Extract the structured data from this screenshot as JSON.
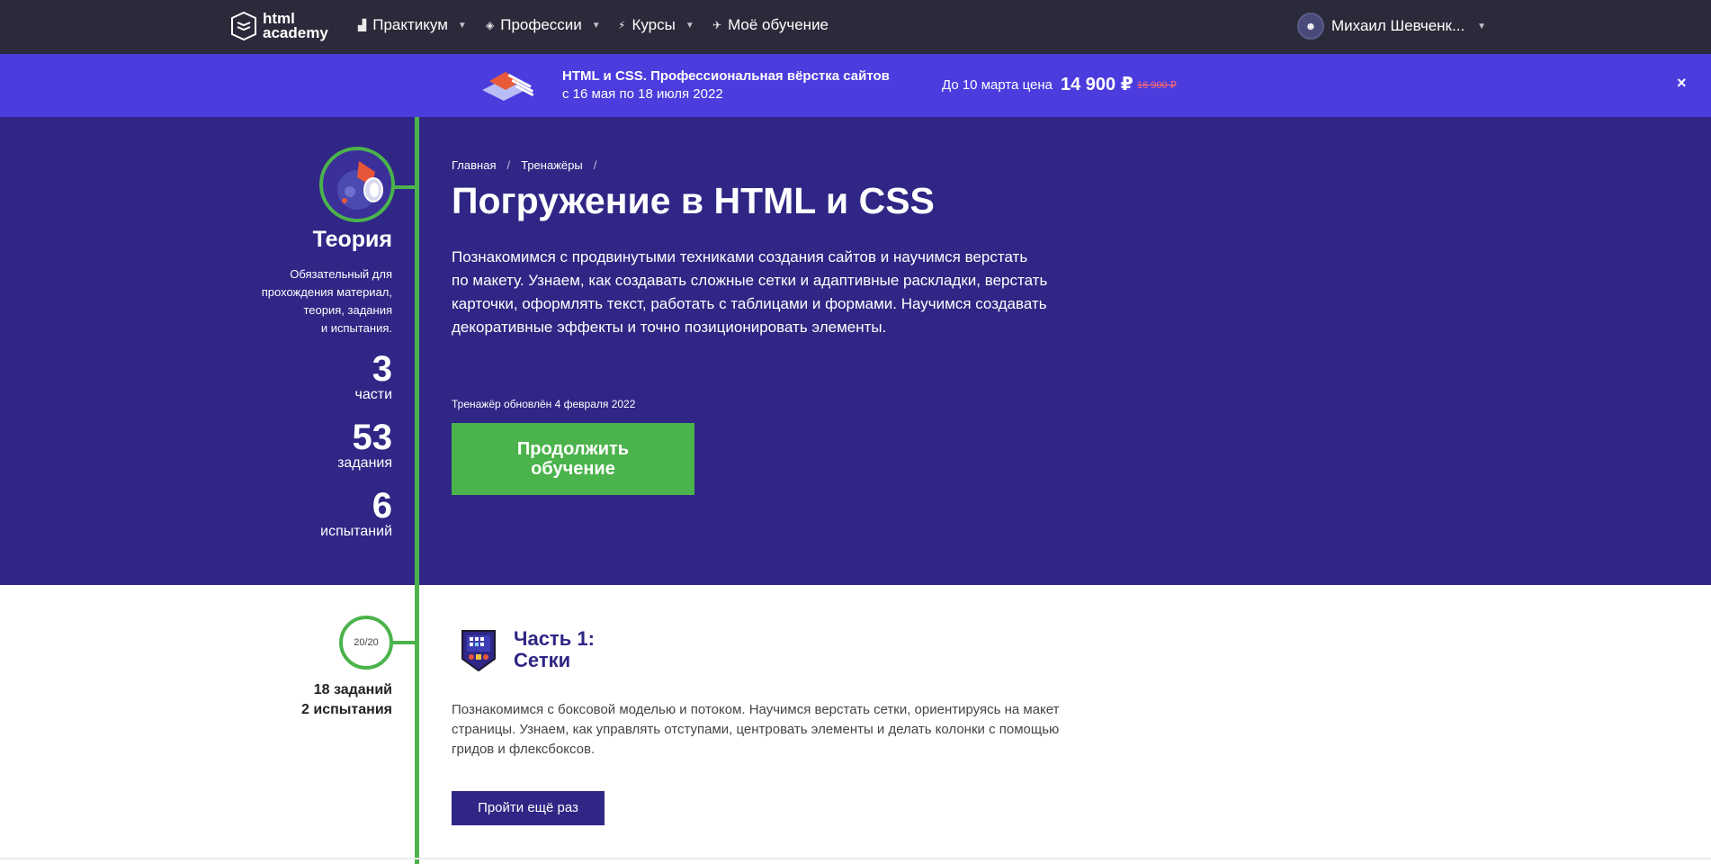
{
  "nav": {
    "logo_line1": "html",
    "logo_line2": "academy",
    "items": [
      {
        "label": "Практикум",
        "icon": "bars-icon",
        "has_caret": true
      },
      {
        "label": "Профессии",
        "icon": "graduation-cap-icon",
        "has_caret": true
      },
      {
        "label": "Курсы",
        "icon": "lightning-icon",
        "has_caret": true
      },
      {
        "label": "Моё обучение",
        "icon": "rocket-icon",
        "has_caret": false
      }
    ],
    "user_name": "Михаил Шевченк..."
  },
  "promo": {
    "title": "HTML и CSS. Профессиональная вёрстка сайтов",
    "dates": "с 16 мая по 18 июля 2022",
    "price_label": "До 10 марта цена",
    "price": "14 900 ₽",
    "old_price": "16 900 ₽",
    "close": "×"
  },
  "sidebar": {
    "theory_title": "Теория",
    "theory_desc_lines": [
      "Обязательный для",
      "прохождения материал,",
      "теория, задания",
      "и испытания."
    ],
    "stats": [
      {
        "num": "3",
        "label": "части"
      },
      {
        "num": "53",
        "label": "задания"
      },
      {
        "num": "6",
        "label": "испытаний"
      }
    ]
  },
  "hero": {
    "breadcrumb": [
      "Главная",
      "Тренажёры"
    ],
    "breadcrumb_sep": "/",
    "title": "Погружение в HTML и CSS",
    "description_lines": [
      "Познакомимся с продвинутыми техниками создания сайтов и научимся верстать",
      "по макету. Узнаем, как создавать сложные сетки и адаптивные раскладки, верстать",
      "карточки, оформлять текст, работать с таблицами и формами. Научимся создавать",
      "декоративные эффекты и точно позиционировать элементы."
    ],
    "updated": "Тренажёр обновлён 4 февраля 2022",
    "continue_line1": "Продолжить",
    "continue_line2": "обучение"
  },
  "part1": {
    "progress": "20/20",
    "tasks": "18 заданий",
    "trials": "2 испытания",
    "title_line1": "Часть 1:",
    "title_line2": "Сетки",
    "description_lines": [
      "Познакомимся с боксовой моделью и потоком. Научимся верстать сетки, ориентируясь на макет",
      "страницы. Узнаем, как управлять отступами, центровать элементы и делать колонки с помощью",
      "гридов и флексбоксов."
    ],
    "retry_label": "Пройти ещё раз"
  },
  "colors": {
    "nav_bg": "#2a2a3a",
    "promo_bg": "#4b3cde",
    "hero_bg": "#2f2685",
    "accent_green": "#4bb34b"
  }
}
